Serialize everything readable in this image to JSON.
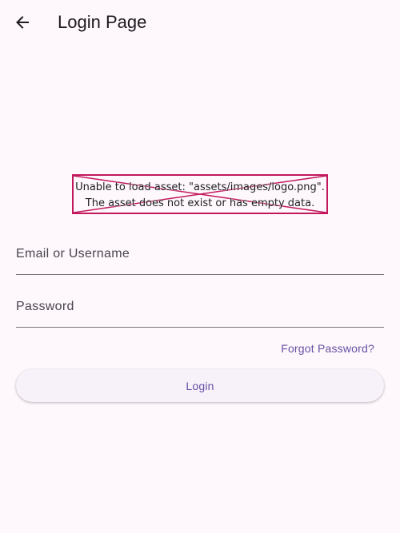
{
  "appbar": {
    "title": "Login Page",
    "back_icon": "arrow-left-icon"
  },
  "logo": {
    "error_line1": "Unable to load asset: \"assets/images/logo.png\".",
    "error_line2": "The asset does not exist or has empty data.",
    "error_color": "#c2185b"
  },
  "form": {
    "email_placeholder": "Email or Username",
    "password_placeholder": "Password",
    "forgot_label": "Forgot Password?",
    "login_label": "Login"
  },
  "colors": {
    "background": "#fef7fc",
    "primary": "#6750a4",
    "button_bg": "#f7f2fa",
    "underline": "#79747e"
  }
}
